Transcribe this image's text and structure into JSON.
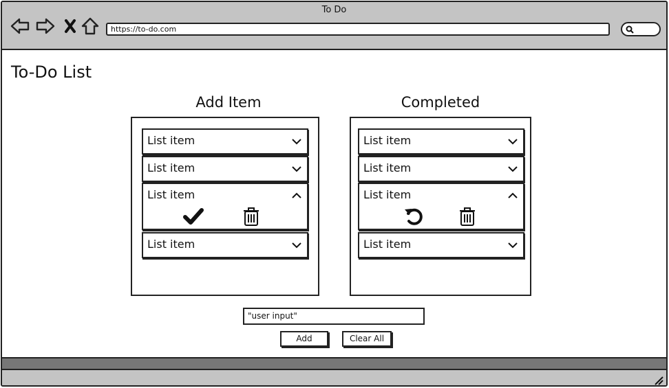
{
  "window": {
    "title": "To Do"
  },
  "browser": {
    "url": "https://to-do.com",
    "nav": [
      "back-icon",
      "forward-icon",
      "close-icon",
      "home-icon"
    ]
  },
  "page": {
    "title": "To-Do List"
  },
  "add_column": {
    "title": "Add Item",
    "items": [
      {
        "label": "List item",
        "expanded": false
      },
      {
        "label": "List item",
        "expanded": false
      },
      {
        "label": "List item",
        "expanded": true,
        "actions": [
          "check-icon",
          "trash-icon"
        ]
      },
      {
        "label": "List item",
        "expanded": false
      }
    ]
  },
  "completed_column": {
    "title": "Completed",
    "items": [
      {
        "label": "List item",
        "expanded": false
      },
      {
        "label": "List item",
        "expanded": false
      },
      {
        "label": "List item",
        "expanded": true,
        "actions": [
          "undo-icon",
          "trash-icon"
        ]
      },
      {
        "label": "List item",
        "expanded": false
      }
    ]
  },
  "form": {
    "input_value": "\"user input\"",
    "add_label": "Add",
    "clear_label": "Clear All"
  },
  "colors": {
    "chrome": "#c4c4c4",
    "ink": "#222222",
    "statusbar": "#777777"
  }
}
